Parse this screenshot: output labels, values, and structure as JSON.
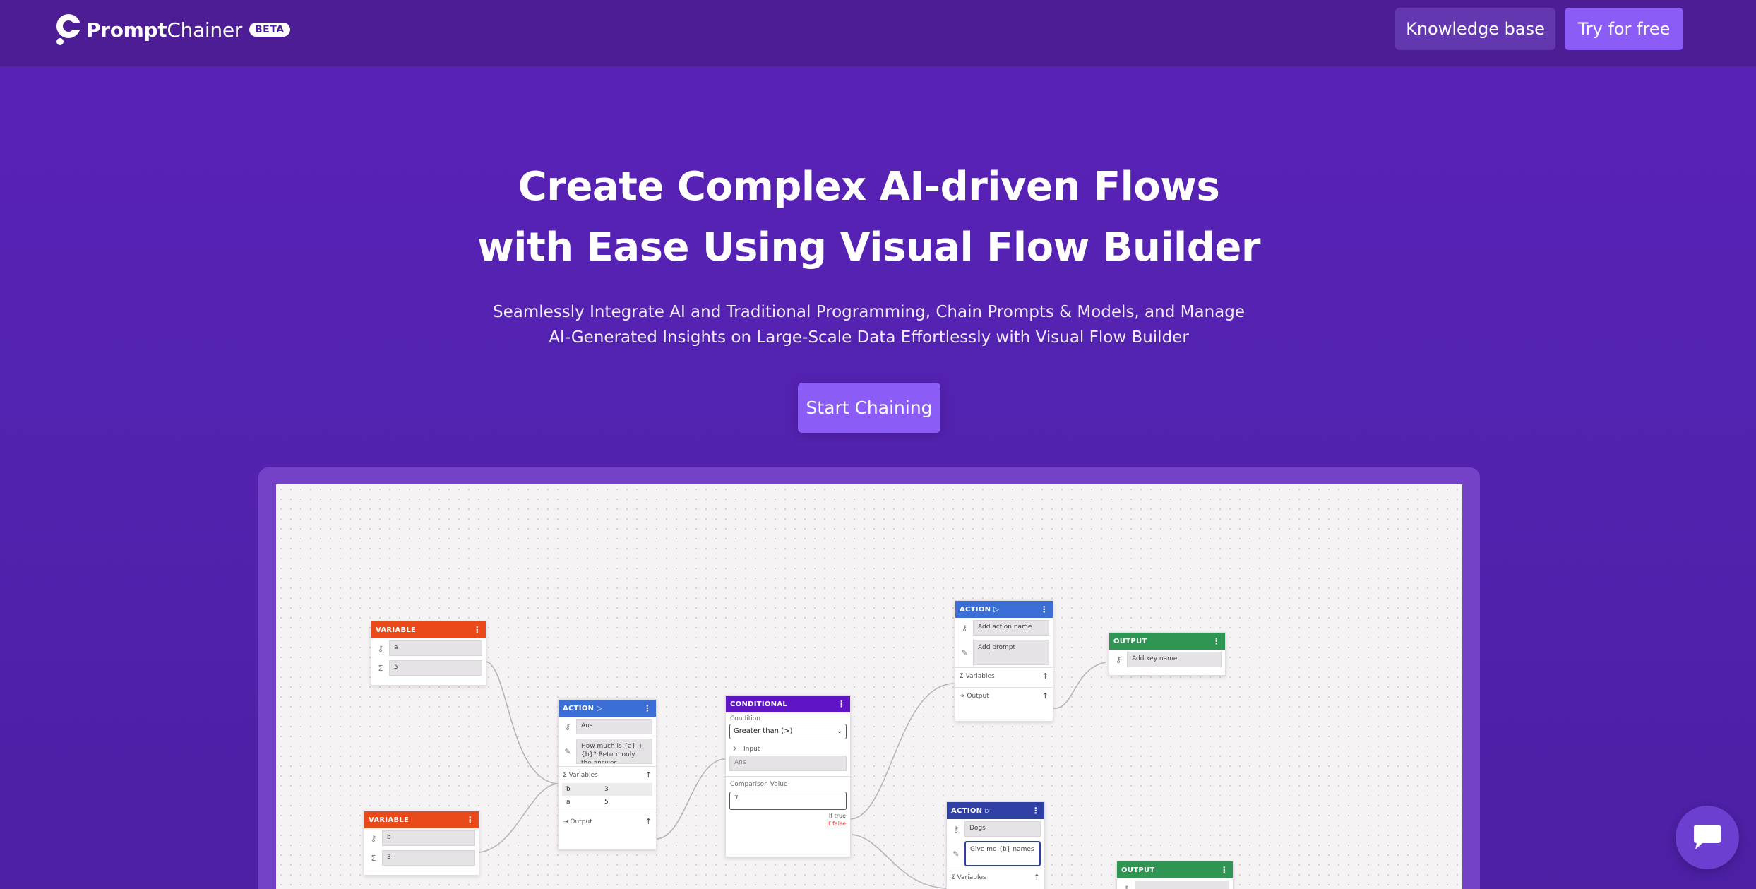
{
  "nav": {
    "brand_bold": "Prompt",
    "brand_rest": "Chainer",
    "beta": "BETA",
    "knowledge_base": "Knowledge base",
    "try_free": "Try for free"
  },
  "hero": {
    "title_line1": "Create Complex AI-driven Flows",
    "title_line2": "with Ease Using Visual Flow Builder",
    "subtitle_line1": "Seamlessly Integrate AI and Traditional Programming, Chain Prompts & Models, and Manage",
    "subtitle_line2": "AI-Generated Insights on Large-Scale Data Effortlessly with Visual Flow Builder",
    "cta": "Start Chaining"
  },
  "flow": {
    "var_a": {
      "header": "VARIABLE",
      "name": "a",
      "value": "5"
    },
    "var_b": {
      "header": "VARIABLE",
      "name": "b",
      "value": "3"
    },
    "action1": {
      "header": "ACTION",
      "name": "Ans",
      "prompt": "How much is {a} + {b}? Return only the answer.",
      "variables_label": "Variables",
      "vars": [
        {
          "k": "b",
          "v": "3"
        },
        {
          "k": "a",
          "v": "5"
        }
      ],
      "output_label": "Output"
    },
    "conditional": {
      "header": "CONDITIONAL",
      "condition_label": "Condition",
      "condition_value": "Greater than (>)",
      "input_label": "Input",
      "input_value": "Ans",
      "comparison_label": "Comparison Value",
      "comparison_value": "7",
      "if_true": "If true",
      "if_false": "If false"
    },
    "action2": {
      "header": "ACTION",
      "name_placeholder": "Add action name",
      "prompt_placeholder": "Add prompt",
      "variables_label": "Variables",
      "output_label": "Output"
    },
    "output1": {
      "header": "OUTPUT",
      "key_placeholder": "Add key name"
    },
    "action3": {
      "header": "ACTION",
      "name": "Dogs",
      "prompt": "Give me {b} names",
      "variables_label": "Variables"
    },
    "output2": {
      "header": "OUTPUT"
    }
  }
}
